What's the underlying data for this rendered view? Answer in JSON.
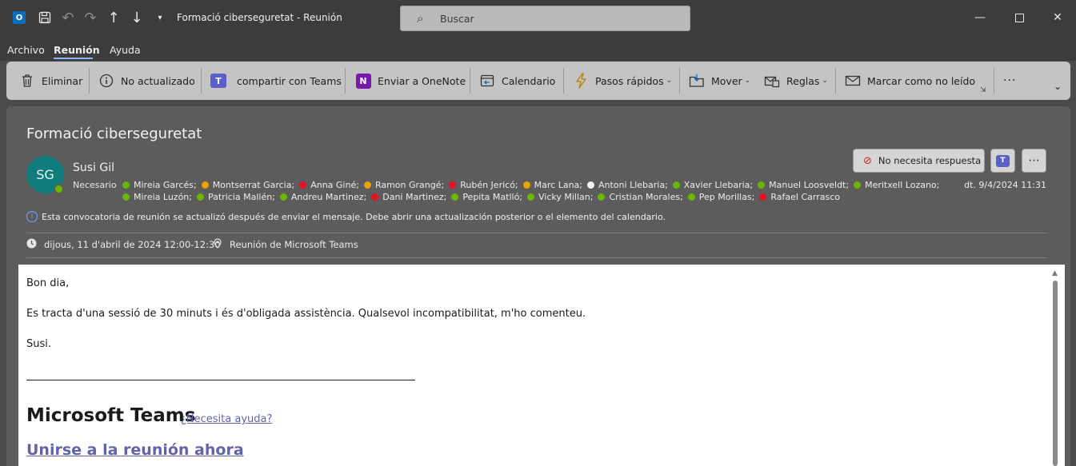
{
  "window": {
    "title": "Formació ciberseguretat  -  Reunión",
    "search_placeholder": "Buscar"
  },
  "menu": {
    "tabs": [
      "Archivo",
      "Reunión",
      "Ayuda"
    ]
  },
  "ribbon": {
    "delete": "Eliminar",
    "not_updated": "No actualizado",
    "share_teams": "compartir con Teams",
    "onenote": "Enviar a OneNote",
    "calendar": "Calendario",
    "quick_steps": "Pasos rápidos",
    "move": "Mover",
    "rules": "Reglas",
    "mark_unread": "Marcar como no leído",
    "more": "···"
  },
  "message": {
    "subject": "Formació ciberseguretat",
    "avatar_initials": "SG",
    "sender": "Susi Gil",
    "required_label": "Necesario",
    "date": "dt. 9/4/2024 11:31",
    "response_button": "No necesita respuesta",
    "attendees_line1": [
      {
        "name": "Mireia Garcés;",
        "status": "accepted"
      },
      {
        "name": "Montserrat Garcia;",
        "status": "tentative"
      },
      {
        "name": "Anna Giné;",
        "status": "declined"
      },
      {
        "name": "Ramon Grangé;",
        "status": "tentative"
      },
      {
        "name": "Rubén Jericó;",
        "status": "declined"
      },
      {
        "name": "Marc Lana;",
        "status": "tentative"
      },
      {
        "name": "Antoni Llebaria;",
        "status": "none"
      },
      {
        "name": "Xavier Llebaria;",
        "status": "accepted"
      },
      {
        "name": "Manuel Loosveldt;",
        "status": "accepted"
      },
      {
        "name": "Meritxell Lozano;",
        "status": "accepted"
      }
    ],
    "attendees_line2": [
      {
        "name": "Mireia Luzón;",
        "status": "accepted"
      },
      {
        "name": "Patricia  Mallén;",
        "status": "accepted"
      },
      {
        "name": "Andreu Martinez;",
        "status": "accepted"
      },
      {
        "name": "Dani Martinez;",
        "status": "declined"
      },
      {
        "name": "Pepita Matlló;",
        "status": "accepted"
      },
      {
        "name": "Vicky Millan;",
        "status": "accepted"
      },
      {
        "name": "Cristian Morales;",
        "status": "accepted"
      },
      {
        "name": "Pep Morillas;",
        "status": "accepted"
      },
      {
        "name": "Rafael Carrasco",
        "status": "declined"
      }
    ],
    "info_notice": "Esta convocatoria de reunión se actualizó después de enviar el mensaje. Debe abrir una actualización posterior o el elemento del calendario.",
    "when": "dijous, 11 d'abril de 2024 12:00-12:30",
    "where": "Reunión de Microsoft Teams"
  },
  "body": {
    "greeting": "Bon dia,",
    "paragraph": "Es tracta d'una sessió de 30 minuts i és d'obligada assistència. Qualsevol incompatibilitat, m'ho comenteu.",
    "signoff": "Susi.",
    "teams_heading": "Microsoft Teams",
    "help_link": "¿Necesita ayuda?",
    "join_link": "Unirse a la reunión ahora"
  }
}
